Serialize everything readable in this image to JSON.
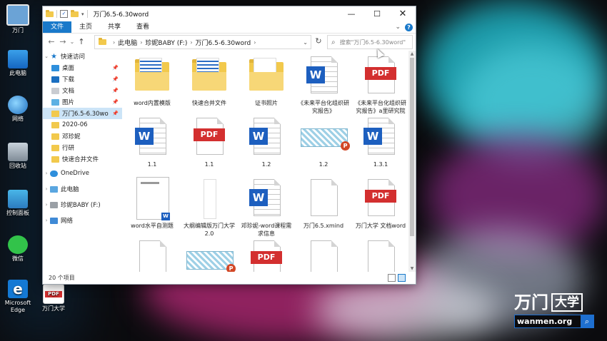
{
  "window": {
    "title": "万门6.5-6.30word",
    "controls": {
      "minimize": "—",
      "maximize": "☐",
      "close": "✕"
    }
  },
  "ribbon": {
    "tabs": [
      "文件",
      "主页",
      "共享",
      "查看"
    ],
    "expand_glyph": "⌄",
    "help_glyph": "?"
  },
  "address": {
    "back": "←",
    "forward": "→",
    "recent": "⌄",
    "up": "↑",
    "crumbs": [
      "此电脑",
      "珍妮BABY (F:)",
      "万门6.5-6.30word"
    ],
    "dropdown": "⌄",
    "refresh": "↻",
    "search_placeholder": "搜索\"万门6.5-6.30word\""
  },
  "nav": {
    "quick_access": "快速访问",
    "pinned": [
      {
        "label": "桌面",
        "icon": "desktop-icon"
      },
      {
        "label": "下载",
        "icon": "download-icon"
      },
      {
        "label": "文档",
        "icon": "documents-icon"
      },
      {
        "label": "图片",
        "icon": "pictures-icon"
      },
      {
        "label": "万门6.5-6.30wo",
        "icon": "folder-icon"
      }
    ],
    "folders": [
      "2020-06",
      "邓珍妮",
      "行研",
      "快速合并文件"
    ],
    "onedrive": "OneDrive",
    "this_pc": "此电脑",
    "drive": "珍妮BABY (F:)",
    "network": "网络"
  },
  "files": [
    {
      "label": "word内置模版",
      "type": "folder-doc"
    },
    {
      "label": "快速合并文件",
      "type": "folder-doc"
    },
    {
      "label": "证书照片",
      "type": "folder"
    },
    {
      "label": "《未来平台化组织研究报告》",
      "type": "word"
    },
    {
      "label": "《未来平台化组织研究报告》a里研究院",
      "type": "pdf"
    },
    {
      "label": "1.1",
      "type": "word"
    },
    {
      "label": "1.1",
      "type": "pdf"
    },
    {
      "label": "1.2",
      "type": "word"
    },
    {
      "label": "1.2",
      "type": "ppt"
    },
    {
      "label": "1.3.1",
      "type": "word"
    },
    {
      "label": "word水平自测题",
      "type": "word-thumb"
    },
    {
      "label": "大纲编辑版万门大学2.0",
      "type": "slim"
    },
    {
      "label": "邓珍妮-word课程需求信息",
      "type": "word"
    },
    {
      "label": "万门6.5.xmind",
      "type": "blank"
    },
    {
      "label": "万门大学 文档word",
      "type": "pdf"
    },
    {
      "label": "",
      "type": "blank"
    },
    {
      "label": "",
      "type": "ppt"
    },
    {
      "label": "",
      "type": "pdf"
    },
    {
      "label": "",
      "type": "blank"
    },
    {
      "label": "",
      "type": "blank"
    }
  ],
  "status": {
    "count": "20 个项目"
  },
  "desktop": [
    {
      "label": "万门",
      "icon": "user-folder-icon"
    },
    {
      "label": "此电脑",
      "icon": "this-pc-icon"
    },
    {
      "label": "网络",
      "icon": "network-icon"
    },
    {
      "label": "回收站",
      "icon": "recycle-bin-icon"
    },
    {
      "label": "控制面板",
      "icon": "control-panel-icon"
    },
    {
      "label": "微信",
      "icon": "wechat-icon"
    },
    {
      "label": "Microsoft Edge",
      "icon": "edge-icon"
    },
    {
      "label": "万门大学",
      "icon": "pdf-file-icon"
    }
  ],
  "desktop_badges": {
    "pdf": "PDF",
    "edge": "e"
  },
  "badges": {
    "word": "W",
    "pdf": "PDF",
    "ppt": "P"
  },
  "logo": {
    "text": "万门",
    "box": "大学",
    "url": "wanmen.org",
    "lens": "⌕"
  },
  "colors": {
    "accent": "#1979ca",
    "word": "#1d5fbf",
    "pdf": "#d32f2f",
    "folder": "#f2c94c"
  }
}
